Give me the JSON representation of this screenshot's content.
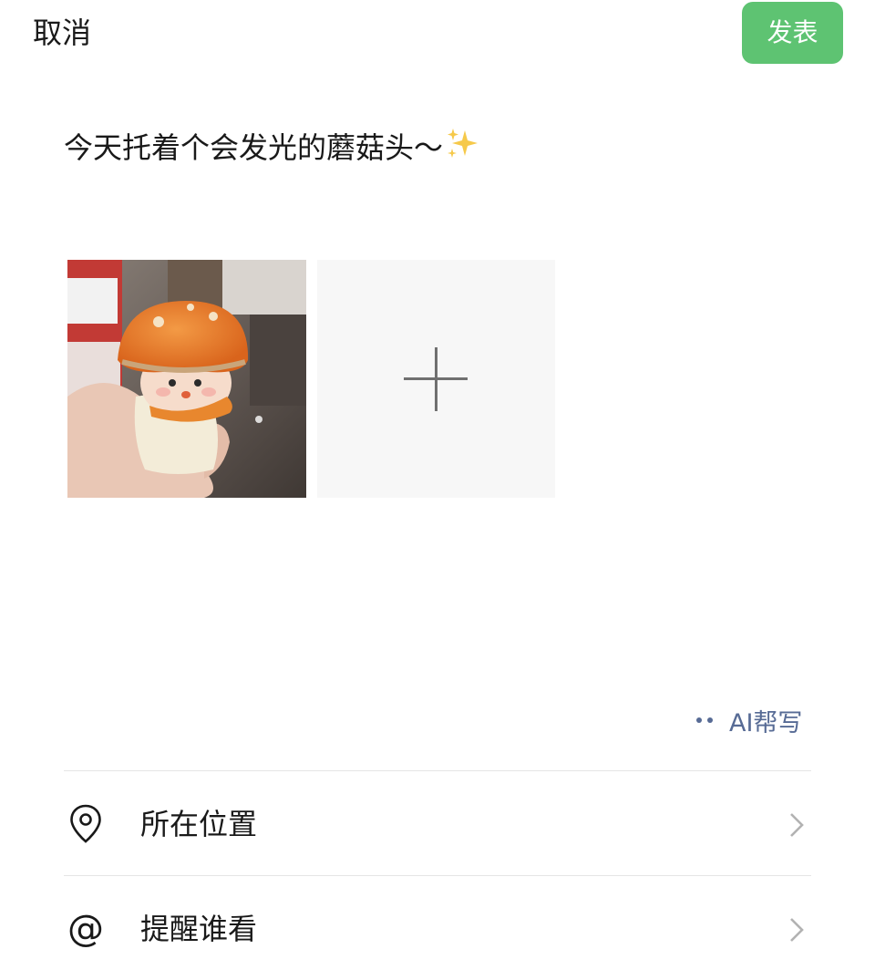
{
  "header": {
    "cancel_label": "取消",
    "publish_label": "发表",
    "publish_color": "#5ec372"
  },
  "post": {
    "text": "今天托着个会发光的蘑菇头～",
    "emoji_icon": "sparkles-icon"
  },
  "media": {
    "photo_icon": "photo-thumbnail",
    "add_icon": "plus-icon"
  },
  "ai_help": {
    "label": "AI帮写",
    "icon": "dots-icon",
    "color": "#576b95"
  },
  "options": [
    {
      "label": "所在位置",
      "icon": "location-pin-icon"
    },
    {
      "label": "提醒谁看",
      "icon": "at-icon",
      "glyph": "@"
    }
  ]
}
